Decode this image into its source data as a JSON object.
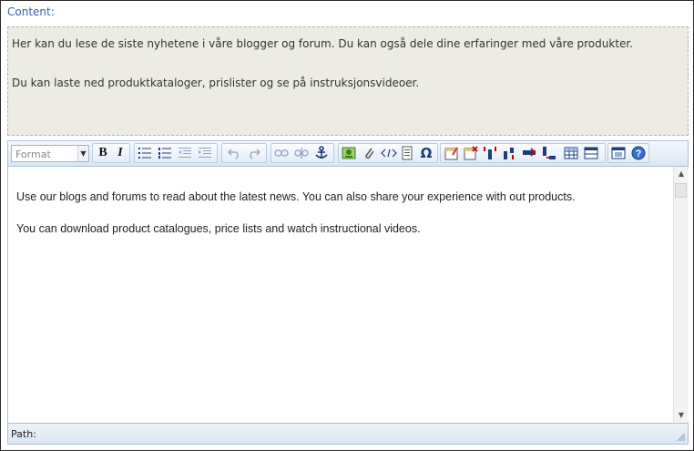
{
  "content_label": "Content:",
  "preview": {
    "paragraphs": [
      "Her kan du lese de siste nyhetene i våre blogger og forum. Du kan også dele dine erfaringer med våre produkter.",
      "Du kan laste ned produktkataloger, prislister og se på instruksjonsvideoer."
    ]
  },
  "editor": {
    "format_select": {
      "value": "Format"
    },
    "toolbar": {
      "bold_label": "B",
      "italic_label": "I",
      "special_char_label": "Ω",
      "icons": [
        "bold-icon",
        "italic-icon",
        "bullet-list-icon",
        "numbered-list-icon",
        "outdent-icon",
        "indent-icon",
        "undo-icon",
        "redo-icon",
        "link-icon",
        "unlink-icon",
        "anchor-icon",
        "image-icon",
        "attachment-icon",
        "html-source-icon",
        "template-icon",
        "special-char-icon",
        "table-props-icon",
        "delete-table-icon",
        "insert-col-icon",
        "insert-row-icon",
        "merge-cells-icon",
        "split-cells-icon",
        "insert-table-icon",
        "table-grid-icon",
        "fullscreen-icon",
        "help-icon"
      ]
    },
    "body": {
      "paragraphs": [
        "Use our blogs and forums to read about the latest news. You can also share your experience with out products.",
        "You can download product catalogues, price lists and watch instructional videos."
      ]
    },
    "status": {
      "path_label": "Path:"
    }
  }
}
